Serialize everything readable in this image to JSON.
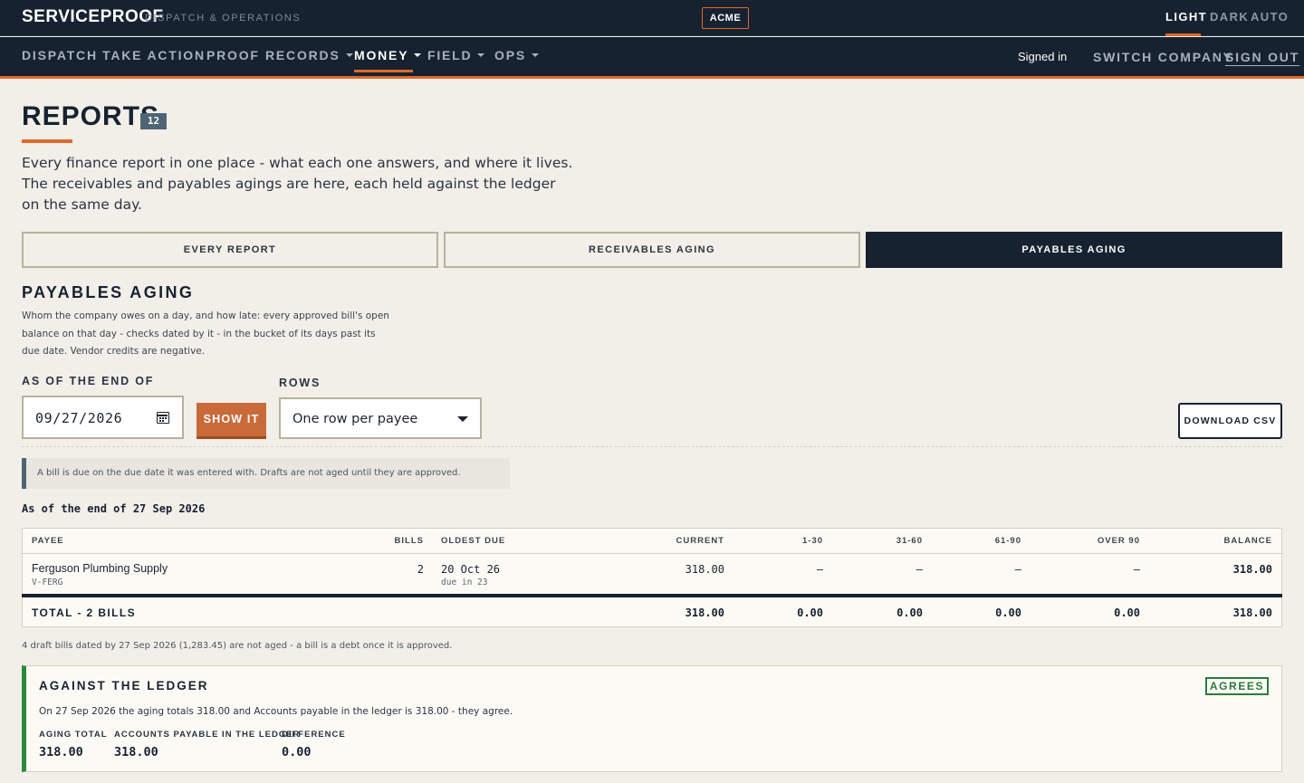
{
  "topbar": {
    "brand": "SERVICEPROOF",
    "tagline": "DISPATCH & OPERATIONS",
    "company_badge": "ACME",
    "theme_options": [
      "LIGHT",
      "DARK",
      "AUTO"
    ]
  },
  "nav": {
    "items": [
      "DISPATCH",
      "TAKE ACTION",
      "PROOF",
      "RECORDS",
      "MONEY",
      "FIELD",
      "OPS"
    ],
    "active": "MONEY",
    "signed_in": "Signed in",
    "switch_company": "SWITCH COMPANY",
    "sign_out": "SIGN OUT"
  },
  "page": {
    "title": "REPORTS",
    "count": "12",
    "intro": "Every finance report in one place - what each one answers, and where it lives. The receivables and payables agings are here, each held against the ledger on the same day."
  },
  "tabs": [
    "EVERY REPORT",
    "RECEIVABLES AGING",
    "PAYABLES AGING"
  ],
  "active_tab": "PAYABLES AGING",
  "section": {
    "title": "PAYABLES AGING",
    "description": "Whom the company owes on a day, and how late: every approved bill's open balance on that day - checks dated by it - in the bucket of its days past its due date. Vendor credits are negative."
  },
  "controls": {
    "date_label": "AS OF THE END OF",
    "date_value": "09/27/2026",
    "show_button": "SHOW IT",
    "rows_label": "ROWS",
    "rows_value": "One row per payee",
    "download_button": "DOWNLOAD CSV"
  },
  "note": "A bill is due on the due date it was entered with. Drafts are not aged until they are approved.",
  "as_of_text": "As of the end of 27 Sep 2026",
  "table": {
    "headers": [
      "PAYEE",
      "BILLS",
      "OLDEST DUE",
      "CURRENT",
      "1-30",
      "31-60",
      "61-90",
      "OVER 90",
      "BALANCE"
    ],
    "rows": [
      {
        "payee": "Ferguson Plumbing Supply",
        "code": "V-FERG",
        "bills": "2",
        "oldest_due": "20 Oct 26",
        "due_in": "due in 23",
        "current": "318.00",
        "b1_30": "—",
        "b31_60": "—",
        "b61_90": "—",
        "over_90": "—",
        "balance": "318.00"
      }
    ],
    "total": {
      "label": "TOTAL - 2 BILLS",
      "current": "318.00",
      "b1_30": "0.00",
      "b31_60": "0.00",
      "b61_90": "0.00",
      "over_90": "0.00",
      "balance": "318.00"
    }
  },
  "footnote": "4 draft bills dated by 27 Sep 2026 (1,283.45) are not aged - a bill is a debt once it is approved.",
  "ledger": {
    "title": "AGAINST THE LEDGER",
    "status": "AGREES",
    "text": "On 27 Sep 2026 the aging totals 318.00 and Accounts payable in the ledger is 318.00 - they agree.",
    "aging_total_label": "AGING TOTAL",
    "aging_total": "318.00",
    "ap_label": "ACCOUNTS PAYABLE IN THE LEDGER",
    "ap_value": "318.00",
    "difference_label": "DIFFERENCE",
    "difference": "0.00"
  },
  "colors": {
    "accent": "#e0682a",
    "navy": "#172230",
    "success": "#2d8a3e",
    "background": "#f2efe9"
  }
}
